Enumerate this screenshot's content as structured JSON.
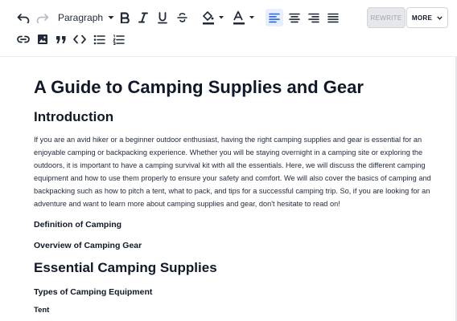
{
  "toolbar": {
    "paragraph_label": "Paragraph",
    "rewrite_label": "REWRITE",
    "more_label": "MORE",
    "accent_color": "#2563eb",
    "icons": [
      "undo-icon",
      "redo-icon",
      "chevron-down-icon",
      "bold-icon",
      "italic-icon",
      "underline-icon",
      "strikethrough-icon",
      "fill-color-icon",
      "text-color-icon",
      "align-left-icon",
      "align-center-icon",
      "align-right-icon",
      "align-justify-icon",
      "link-icon",
      "image-icon",
      "quote-icon",
      "code-icon",
      "bullet-list-icon",
      "numbered-list-icon"
    ]
  },
  "document": {
    "title": "A Guide to Camping Supplies and Gear",
    "intro_heading": "Introduction",
    "intro_paragraph": "If you are an avid hiker or a beginner outdoor enthusiast, having the right camping supplies and gear is essential for an enjoyable camping or backpacking experience. Whether you will be staying overnight in a camping site or exploring the outdoors, it is important to have a camping survival kit with all the essentials. Here, we will discuss the different camping equipment and how to use them properly to ensure your safety and comfort. We will also cover the basics of camping and backpacking such as how to pitch a tent, what to pack, and tips for a successful camping trip. So, if you are looking for an adventure and want to learn more about camping supplies and gear, don't hesitate to read on!",
    "definition_heading": "Definition of Camping",
    "overview_heading": "Overview of Camping Gear",
    "essential_heading": "Essential Camping Supplies",
    "types_heading": "Types of Camping Equipment",
    "tent_heading": "Tent"
  }
}
